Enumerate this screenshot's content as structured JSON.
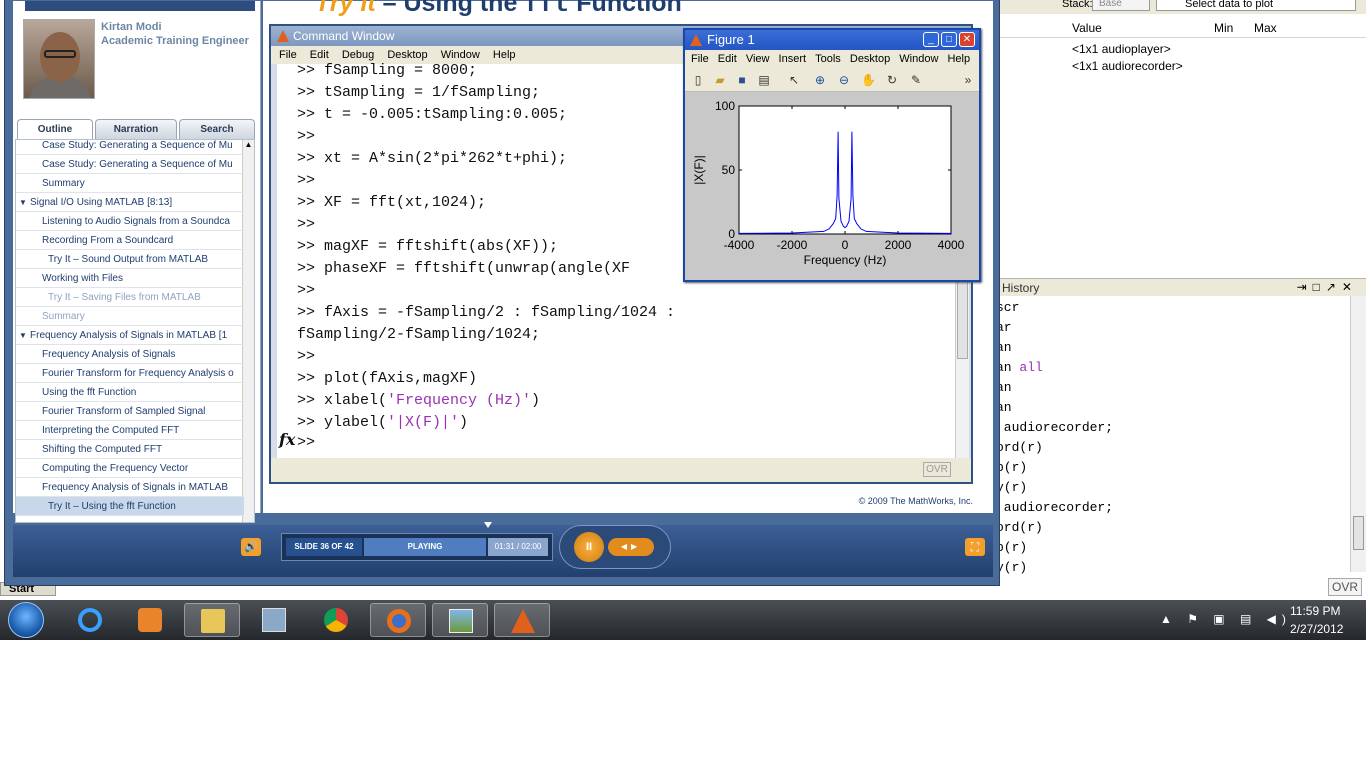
{
  "workspace": {
    "stack_label": "Stack:",
    "stack_value": "Base",
    "plot_select": "Select data to plot",
    "columns": [
      "Value",
      "Min",
      "Max"
    ],
    "rows": [
      "<1x1 audioplayer>",
      "<1x1 audiorecorder>"
    ]
  },
  "history": {
    "title": "History",
    "lines": [
      "scr",
      "ar",
      "an",
      "an all",
      "an",
      "an",
      " audiorecorder;",
      "ord(r)",
      "p(r)",
      "y(r)",
      " audiorecorder;",
      "ord(r)",
      "p(r)",
      "y(r)"
    ],
    "ovr": "OVR"
  },
  "start_tab": "Start",
  "presenter": {
    "name": "Kirtan Modi",
    "title": "Academic Training Engineer"
  },
  "tabs": [
    "Outline",
    "Narration",
    "Search"
  ],
  "outline": [
    {
      "label": "Case Study: Generating a Sequence of Mu",
      "level": 2,
      "state": ""
    },
    {
      "label": "Case Study: Generating a Sequence of Mu",
      "level": 2,
      "state": ""
    },
    {
      "label": "Summary",
      "level": 2,
      "state": ""
    },
    {
      "label": "Signal I/O Using MATLAB  [8:13]",
      "level": 1,
      "state": "section"
    },
    {
      "label": "Listening to Audio Signals from a Soundca",
      "level": 2,
      "state": ""
    },
    {
      "label": "Recording From a Soundcard",
      "level": 2,
      "state": ""
    },
    {
      "label": "Try It – Sound Output from MATLAB",
      "level": 3,
      "state": ""
    },
    {
      "label": "Working with Files",
      "level": 2,
      "state": ""
    },
    {
      "label": "Try It – Saving Files from MATLAB",
      "level": 3,
      "state": "dim"
    },
    {
      "label": "Summary",
      "level": 2,
      "state": "dim"
    },
    {
      "label": "Frequency Analysis of Signals in MATLAB  [1",
      "level": 1,
      "state": "section"
    },
    {
      "label": "Frequency Analysis of Signals",
      "level": 2,
      "state": ""
    },
    {
      "label": "Fourier Transform for Frequency Analysis o",
      "level": 2,
      "state": ""
    },
    {
      "label": "Using the fft Function",
      "level": 2,
      "state": ""
    },
    {
      "label": "Fourier Transform of Sampled Signal",
      "level": 2,
      "state": ""
    },
    {
      "label": "Interpreting the Computed FFT",
      "level": 2,
      "state": ""
    },
    {
      "label": "Shifting the Computed FFT",
      "level": 2,
      "state": ""
    },
    {
      "label": "Computing the Frequency Vector",
      "level": 2,
      "state": ""
    },
    {
      "label": "Frequency Analysis of Signals in MATLAB",
      "level": 2,
      "state": ""
    },
    {
      "label": "Try It – Using the fft Function",
      "level": 3,
      "state": "sel"
    }
  ],
  "slide": {
    "title_prefix": "Try It",
    "title_mid": " – Using the ",
    "title_code": "fft",
    "title_suffix": " Function",
    "copyright": "© 2009 The MathWorks, Inc."
  },
  "command_window": {
    "title": "Command Window",
    "menu": [
      "File",
      "Edit",
      "Debug",
      "Desktop",
      "Window",
      "Help"
    ],
    "lines": [
      {
        "code": ">> fSampling = 8000;",
        "str": ""
      },
      {
        "code": ">> tSampling = 1/fSampling;",
        "str": ""
      },
      {
        "code": ">> t = -0.005:tSampling:0.005;",
        "str": ""
      },
      {
        "code": ">>",
        "str": ""
      },
      {
        "code": ">> xt = A*sin(2*pi*262*t+phi);",
        "str": ""
      },
      {
        "code": ">>",
        "str": ""
      },
      {
        "code": ">> XF = fft(xt,1024);",
        "str": ""
      },
      {
        "code": ">>",
        "str": ""
      },
      {
        "code": ">> magXF = fftshift(abs(XF));",
        "str": ""
      },
      {
        "code": ">> phaseXF = fftshift(unwrap(angle(XF",
        "str": ""
      },
      {
        "code": ">>",
        "str": ""
      },
      {
        "code": ">> fAxis = -fSampling/2 : fSampling/1024 :",
        "str": ""
      },
      {
        "code": "fSampling/2-fSampling/1024;",
        "str": ""
      },
      {
        "code": ">>",
        "str": ""
      },
      {
        "code": ">> plot(fAxis,magXF)",
        "str": ""
      },
      {
        "code": ">> xlabel(",
        "str": "'Frequency (Hz)'",
        "tail": ")"
      },
      {
        "code": ">> ylabel(",
        "str": "'|X(F)|'",
        "tail": ")"
      }
    ],
    "prompt": ">>",
    "fx": "fx",
    "ovr": "OVR"
  },
  "figure": {
    "title": "Figure 1",
    "menu": [
      "File",
      "Edit",
      "View",
      "Insert",
      "Tools",
      "Desktop",
      "Window",
      "Help"
    ],
    "toolbar_icons": [
      "new-icon",
      "open-icon",
      "save-icon",
      "print-icon",
      "pointer-icon",
      "zoom-in-icon",
      "zoom-out-icon",
      "pan-icon",
      "rotate-icon",
      "datacursor-icon"
    ]
  },
  "chart_data": {
    "type": "line",
    "xlabel": "Frequency (Hz)",
    "ylabel": "|X(F)|",
    "xlim": [
      -4000,
      4000
    ],
    "ylim": [
      0,
      100
    ],
    "xticks": [
      -4000,
      -2000,
      0,
      2000,
      4000
    ],
    "yticks": [
      0,
      50,
      100
    ],
    "series": [
      {
        "color": "#0000ff",
        "x": [
          -4000,
          -2000,
          -800,
          -600,
          -450,
          -350,
          -300,
          -262,
          -230,
          -150,
          -60,
          0,
          60,
          150,
          230,
          262,
          300,
          350,
          450,
          600,
          800,
          2000,
          4000
        ],
        "y": [
          0.5,
          0.8,
          2,
          4,
          8,
          12,
          30,
          80,
          28,
          10,
          6,
          5,
          6,
          10,
          28,
          80,
          30,
          12,
          8,
          4,
          2,
          0.8,
          0.5
        ]
      }
    ]
  },
  "player": {
    "slide_count": "SLIDE 36 OF 42",
    "state": "PLAYING",
    "time": "01:31 / 02:00",
    "pause_glyph": "II"
  },
  "taskbar": {
    "time": "11:59 PM",
    "date": "2/27/2012",
    "apps": [
      "internet-explorer",
      "media-player",
      "file-explorer",
      "calculator",
      "chrome",
      "firefox",
      "image-viewer",
      "matlab"
    ]
  }
}
